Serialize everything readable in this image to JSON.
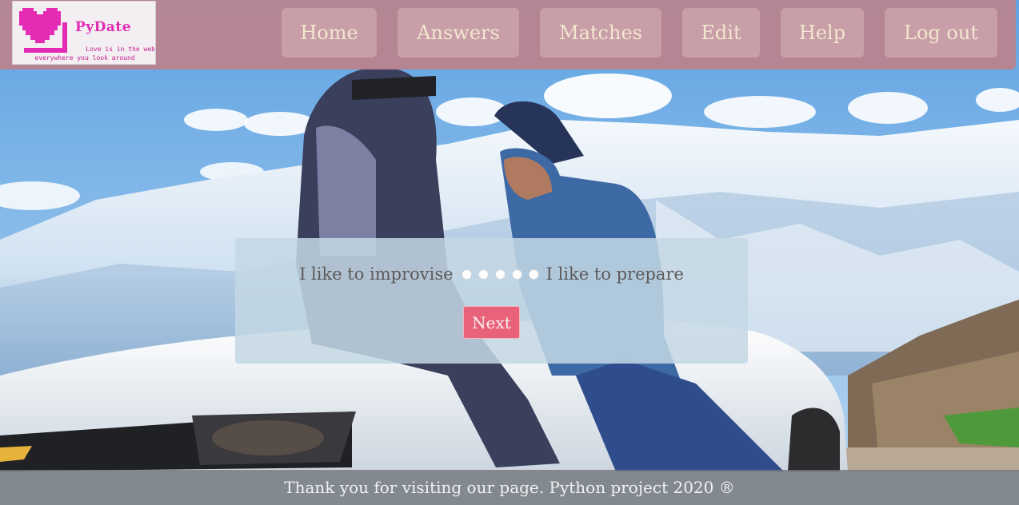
{
  "logo": {
    "title": "PyDate",
    "tagline_line1": "Love is in the web",
    "tagline_line2": "everywhere you look around"
  },
  "nav": {
    "home": "Home",
    "answers": "Answers",
    "matches": "Matches",
    "edit": "Edit",
    "help": "Help",
    "logout": "Log out"
  },
  "question": {
    "left_label": "I like to improvise",
    "right_label": "I like to prepare",
    "options": 5,
    "next_label": "Next"
  },
  "footer": {
    "text": "Thank you for visiting our page. Python project 2020 ®"
  },
  "colors": {
    "header": "#bc828c",
    "logo_pink": "#e02bb3",
    "next_button": "#e8637a",
    "footer": "#78787a"
  }
}
